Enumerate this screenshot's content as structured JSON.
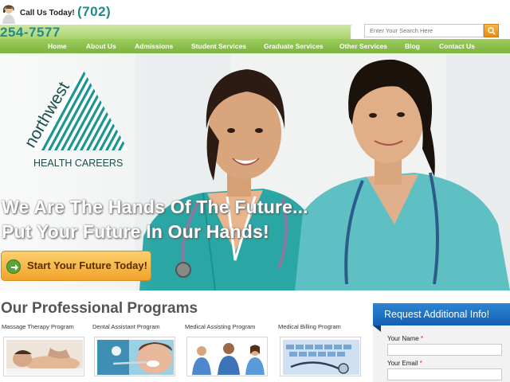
{
  "header": {
    "call_label": "Call Us Today!",
    "phone_part1": "(702)",
    "phone_part2": "254-7577",
    "search": {
      "placeholder": "Enter Your Search Here"
    }
  },
  "nav": {
    "items": [
      {
        "label": "Home"
      },
      {
        "label": "About Us"
      },
      {
        "label": "Admissions"
      },
      {
        "label": "Student Services"
      },
      {
        "label": "Graduate Services"
      },
      {
        "label": "Other Services"
      },
      {
        "label": "Blog"
      },
      {
        "label": "Contact Us"
      }
    ]
  },
  "hero": {
    "logo_word": "northwest",
    "logo_sub": "HEALTH CAREERS",
    "tagline_line1": "We Are The Hands Of The Future...",
    "tagline_line2": "Put Your Future In Our Hands!",
    "cta_label": "Start Your Future Today!"
  },
  "programs": {
    "title": "Our Professional Programs",
    "items": [
      {
        "label": "Massage Therapy Program",
        "icon": "massage-photo"
      },
      {
        "label": "Dental Assistant Program",
        "icon": "dental-photo"
      },
      {
        "label": "Medical Assisting Program",
        "icon": "medical-staff-photo"
      },
      {
        "label": "Medical Billing Program",
        "icon": "keyboard-stethoscope-photo"
      }
    ]
  },
  "info_panel": {
    "title": "Request Additional Info!",
    "name_label": "Your Name",
    "email_label": "Your Email",
    "required_mark": "*"
  },
  "colors": {
    "teal": "#1f8b8b",
    "nav_green": "#8cbf4d",
    "cta_orange": "#f2a32b",
    "panel_blue": "#1e73c3"
  }
}
